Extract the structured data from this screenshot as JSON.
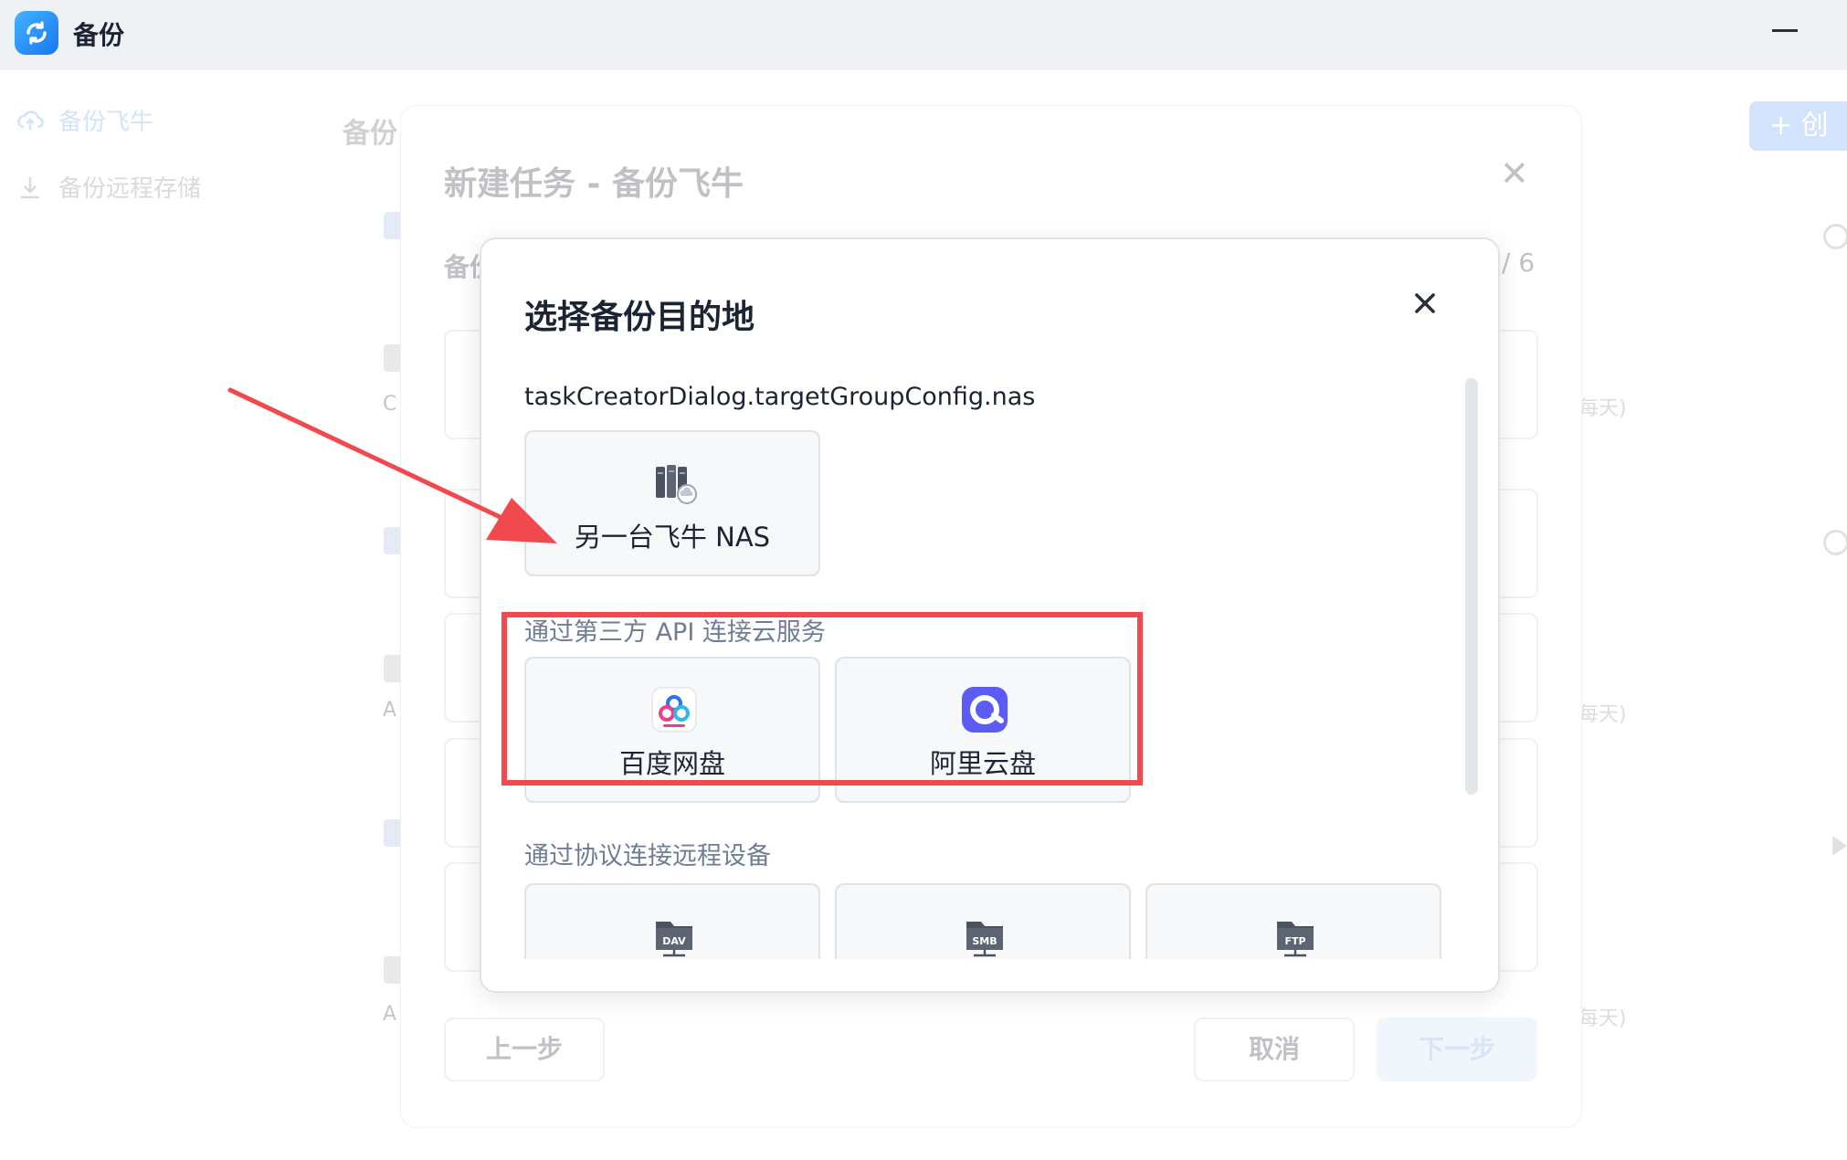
{
  "app": {
    "title": "备份"
  },
  "sidebar": {
    "items": [
      {
        "label": "备份飞牛",
        "icon": "cloud-upload-icon"
      },
      {
        "label": "备份远程存储",
        "icon": "download-icon"
      }
    ]
  },
  "background": {
    "heading": "备份",
    "create_button": "+ 创",
    "frequency_labels": [
      "每天)",
      "每天)",
      "每天)"
    ],
    "row_letters": [
      "C",
      "A",
      "A"
    ]
  },
  "outer_dialog": {
    "title": "新建任务 - 备份飞牛",
    "step_label": "备份",
    "step_count": "/ 6",
    "prev_button": "上一步",
    "cancel_button": "取消",
    "next_button": "下一步"
  },
  "inner_dialog": {
    "title": "选择备份目的地",
    "sections": [
      {
        "label": "taskCreatorDialog.targetGroupConfig.nas",
        "options": [
          {
            "label": "另一台飞牛 NAS",
            "icon": "nas-server-icon"
          }
        ]
      },
      {
        "label": "通过第三方 API 连接云服务",
        "options": [
          {
            "label": "百度网盘",
            "icon": "baidu-netdisk-icon"
          },
          {
            "label": "阿里云盘",
            "icon": "aliyun-drive-icon"
          }
        ]
      },
      {
        "label": "通过协议连接远程设备",
        "options": [
          {
            "label": "",
            "icon": "webdav-icon",
            "badge": "DAV"
          },
          {
            "label": "",
            "icon": "smb-icon",
            "badge": "SMB"
          },
          {
            "label": "",
            "icon": "ftp-icon",
            "badge": "FTP"
          }
        ]
      }
    ]
  },
  "colors": {
    "accent": "#3b82f6",
    "annotation_red": "#f04a4f",
    "muted_text": "#6f7d95"
  }
}
